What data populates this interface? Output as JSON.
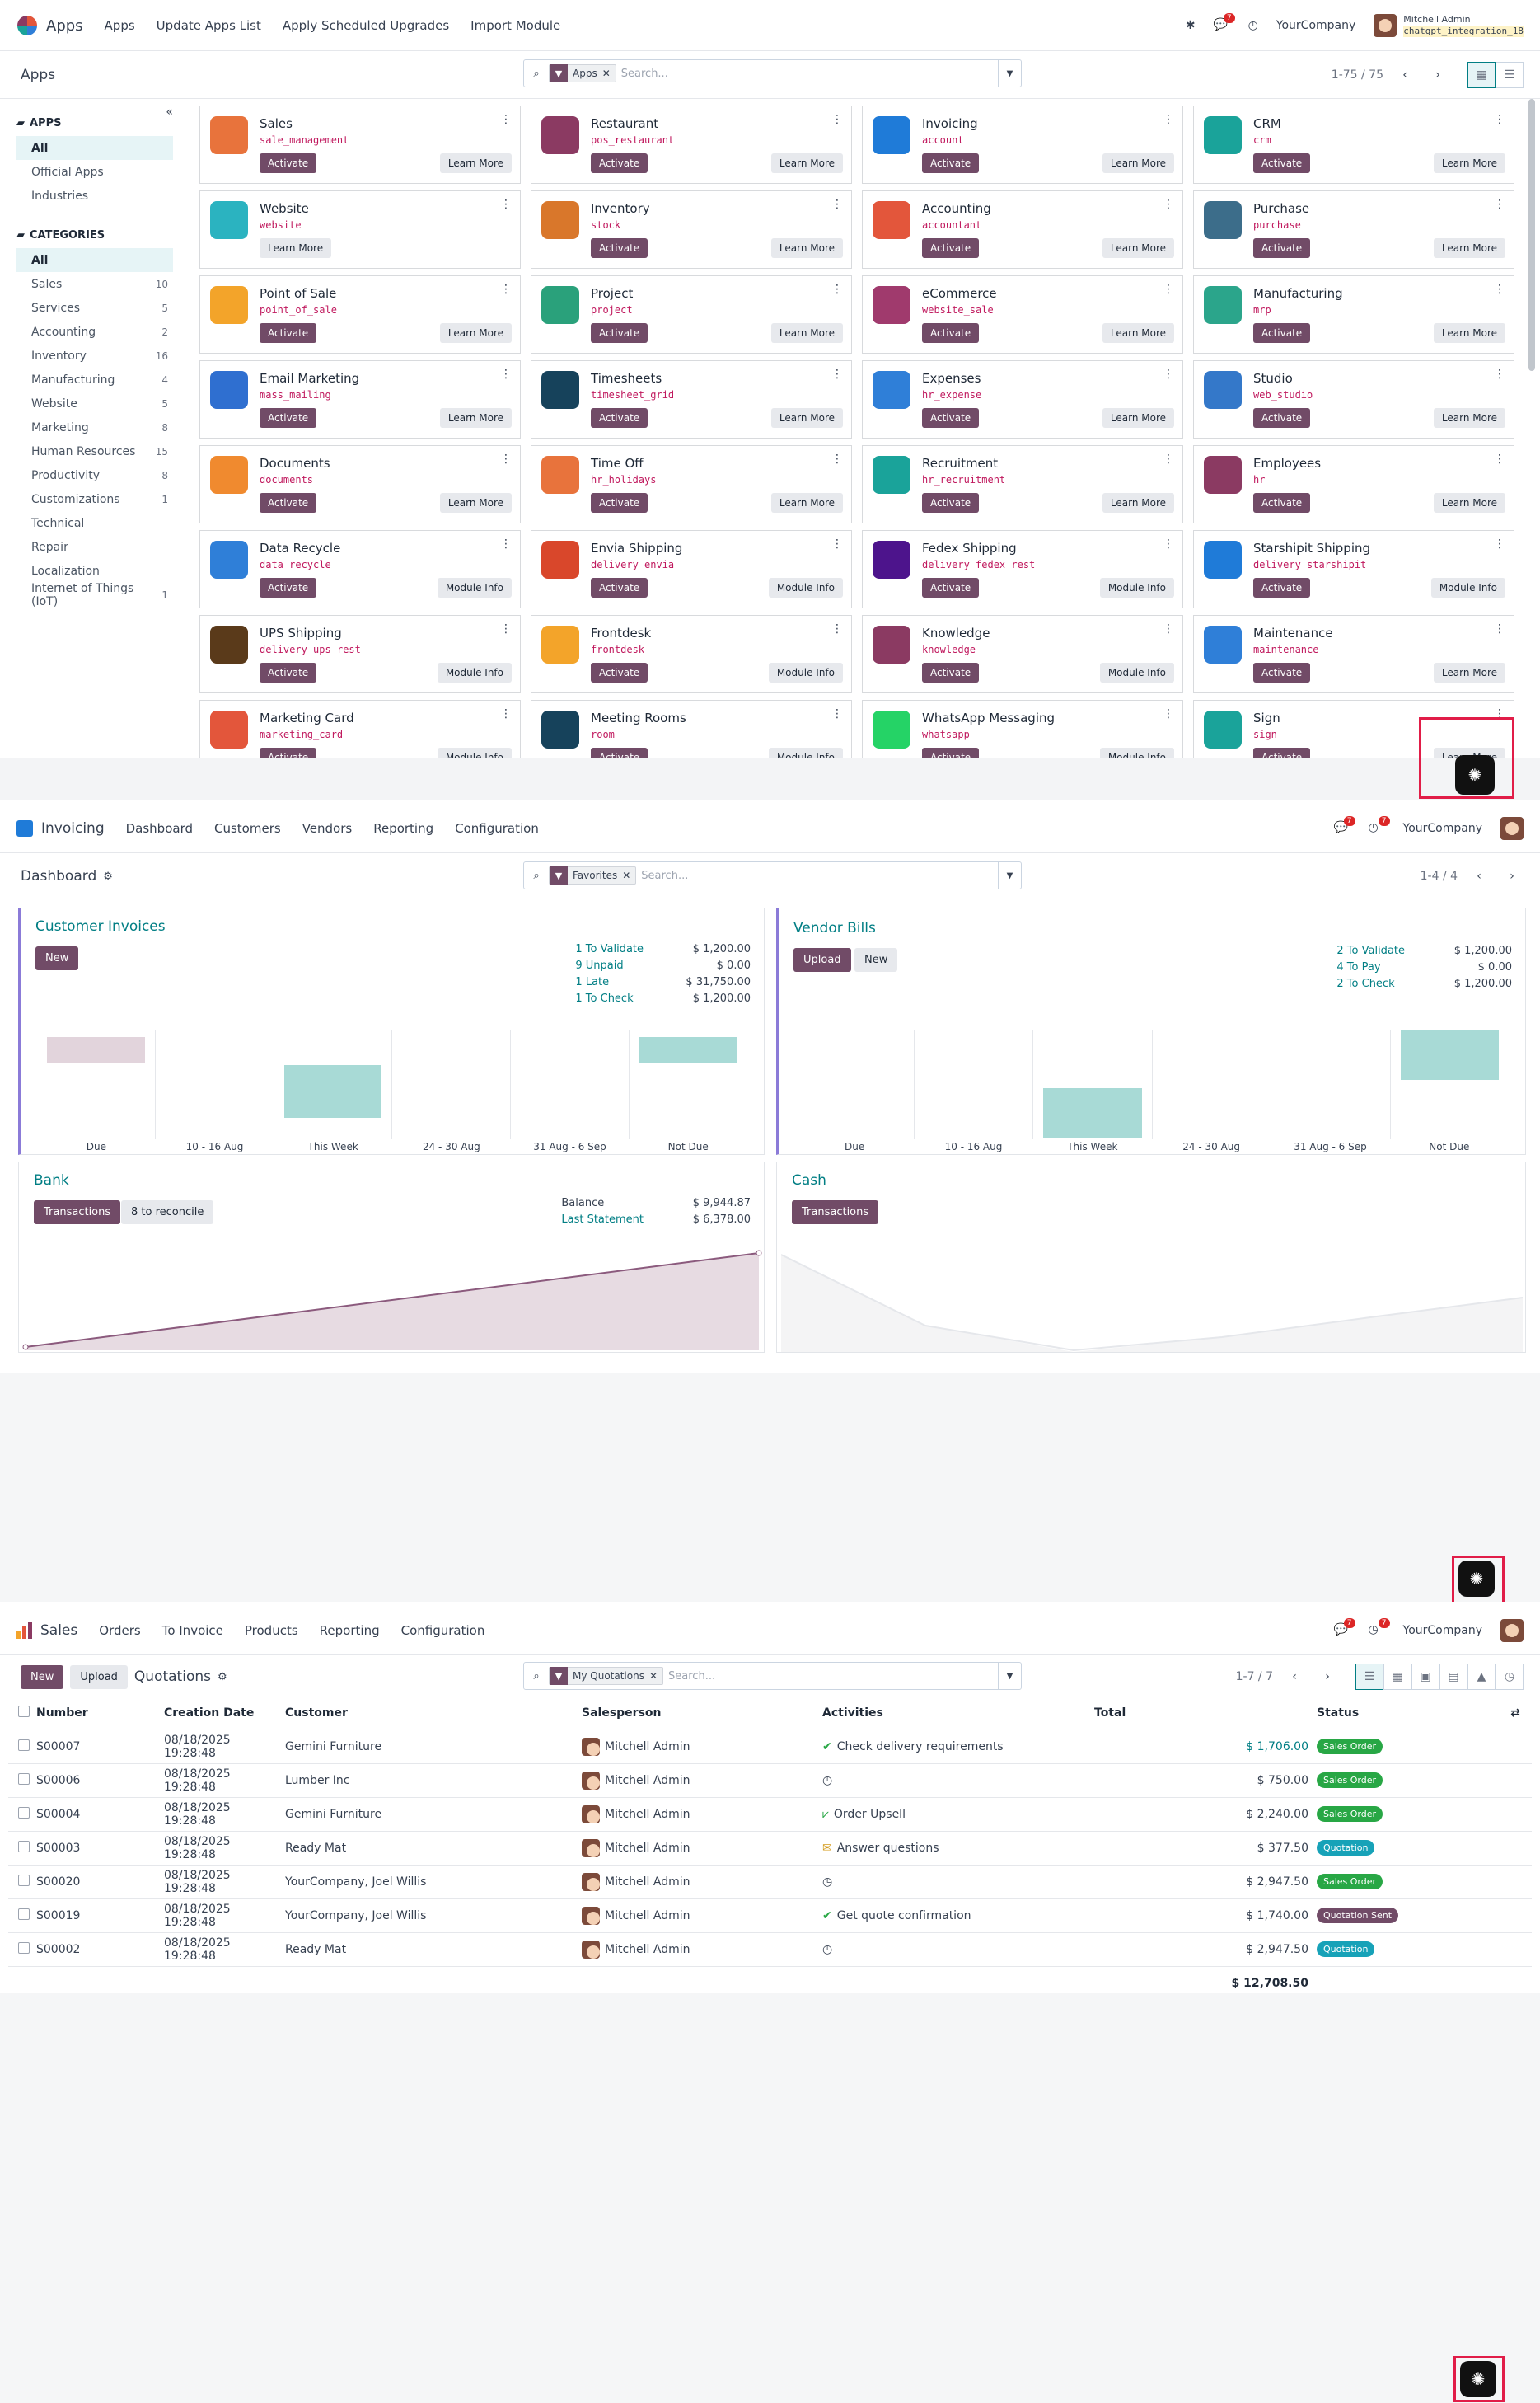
{
  "panel1": {
    "nav": {
      "app": "Apps",
      "menu": [
        "Apps",
        "Update Apps List",
        "Apply Scheduled Upgrades",
        "Import Module"
      ]
    },
    "user": {
      "name": "Mitchell Admin",
      "db": "chatgpt_integration_18",
      "company": "YourCompany",
      "msg_count": "7"
    },
    "breadcrumb": "Apps",
    "search": {
      "facet": "Apps",
      "placeholder": "Search..."
    },
    "pager": "1-75 / 75",
    "sidebar": {
      "apps_title": "APPS",
      "apps": [
        "All",
        "Official Apps",
        "Industries"
      ],
      "cat_title": "CATEGORIES",
      "categories": [
        {
          "label": "All",
          "count": ""
        },
        {
          "label": "Sales",
          "count": "10"
        },
        {
          "label": "Services",
          "count": "5"
        },
        {
          "label": "Accounting",
          "count": "2"
        },
        {
          "label": "Inventory",
          "count": "16"
        },
        {
          "label": "Manufacturing",
          "count": "4"
        },
        {
          "label": "Website",
          "count": "5"
        },
        {
          "label": "Marketing",
          "count": "8"
        },
        {
          "label": "Human Resources",
          "count": "15"
        },
        {
          "label": "Productivity",
          "count": "8"
        },
        {
          "label": "Customizations",
          "count": "1"
        },
        {
          "label": "Technical",
          "count": ""
        },
        {
          "label": "Repair",
          "count": ""
        },
        {
          "label": "Localization",
          "count": ""
        },
        {
          "label": "Internet of Things (IoT)",
          "count": "1"
        }
      ]
    },
    "apps": [
      {
        "name": "Sales",
        "tech": "sale_management",
        "act": "Activate",
        "more": "Learn More",
        "color": "#e8733c"
      },
      {
        "name": "Restaurant",
        "tech": "pos_restaurant",
        "act": "Activate",
        "more": "Learn More",
        "color": "#8b3a62"
      },
      {
        "name": "Invoicing",
        "tech": "account",
        "act": "Activate",
        "more": "Learn More",
        "color": "#1f7bd8"
      },
      {
        "name": "CRM",
        "tech": "crm",
        "act": "Activate",
        "more": "Learn More",
        "color": "#1aa39a"
      },
      {
        "name": "Website",
        "tech": "website",
        "act": "",
        "more": "Learn More",
        "color": "#2bb3c0"
      },
      {
        "name": "Inventory",
        "tech": "stock",
        "act": "Activate",
        "more": "Learn More",
        "color": "#d9772b"
      },
      {
        "name": "Accounting",
        "tech": "accountant",
        "act": "Activate",
        "more": "Learn More",
        "color": "#e3563b"
      },
      {
        "name": "Purchase",
        "tech": "purchase",
        "act": "Activate",
        "more": "Learn More",
        "color": "#3c6d8a"
      },
      {
        "name": "Point of Sale",
        "tech": "point_of_sale",
        "act": "Activate",
        "more": "Learn More",
        "color": "#f3a42a"
      },
      {
        "name": "Project",
        "tech": "project",
        "act": "Activate",
        "more": "Learn More",
        "color": "#2aa17b"
      },
      {
        "name": "eCommerce",
        "tech": "website_sale",
        "act": "Activate",
        "more": "Learn More",
        "color": "#a03a6d"
      },
      {
        "name": "Manufacturing",
        "tech": "mrp",
        "act": "Activate",
        "more": "Learn More",
        "color": "#2ba58b"
      },
      {
        "name": "Email Marketing",
        "tech": "mass_mailing",
        "act": "Activate",
        "more": "Learn More",
        "color": "#2f6fd0"
      },
      {
        "name": "Timesheets",
        "tech": "timesheet_grid",
        "act": "Activate",
        "more": "Learn More",
        "color": "#16425b"
      },
      {
        "name": "Expenses",
        "tech": "hr_expense",
        "act": "Activate",
        "more": "Learn More",
        "color": "#2f7fd8"
      },
      {
        "name": "Studio",
        "tech": "web_studio",
        "act": "Activate",
        "more": "Learn More",
        "color": "#3478c9"
      },
      {
        "name": "Documents",
        "tech": "documents",
        "act": "Activate",
        "more": "Learn More",
        "color": "#f08a2f"
      },
      {
        "name": "Time Off",
        "tech": "hr_holidays",
        "act": "Activate",
        "more": "Learn More",
        "color": "#e8733c"
      },
      {
        "name": "Recruitment",
        "tech": "hr_recruitment",
        "act": "Activate",
        "more": "Learn More",
        "color": "#1aa39a"
      },
      {
        "name": "Employees",
        "tech": "hr",
        "act": "Activate",
        "more": "Learn More",
        "color": "#8b3a62"
      },
      {
        "name": "Data Recycle",
        "tech": "data_recycle",
        "act": "Activate",
        "more": "Module Info",
        "color": "#2f7fd8"
      },
      {
        "name": "Envia Shipping",
        "tech": "delivery_envia",
        "act": "Activate",
        "more": "Module Info",
        "color": "#d9472b"
      },
      {
        "name": "Fedex Shipping",
        "tech": "delivery_fedex_rest",
        "act": "Activate",
        "more": "Module Info",
        "color": "#4d148c"
      },
      {
        "name": "Starshipit Shipping",
        "tech": "delivery_starshipit",
        "act": "Activate",
        "more": "Module Info",
        "color": "#1f7bd8"
      },
      {
        "name": "UPS Shipping",
        "tech": "delivery_ups_rest",
        "act": "Activate",
        "more": "Module Info",
        "color": "#5a3a1a"
      },
      {
        "name": "Frontdesk",
        "tech": "frontdesk",
        "act": "Activate",
        "more": "Module Info",
        "color": "#f3a42a"
      },
      {
        "name": "Knowledge",
        "tech": "knowledge",
        "act": "Activate",
        "more": "Module Info",
        "color": "#8b3a62"
      },
      {
        "name": "Maintenance",
        "tech": "maintenance",
        "act": "Activate",
        "more": "Learn More",
        "color": "#2f7fd8"
      },
      {
        "name": "Marketing Card",
        "tech": "marketing_card",
        "act": "Activate",
        "more": "Module Info",
        "color": "#e3563b"
      },
      {
        "name": "Meeting Rooms",
        "tech": "room",
        "act": "Activate",
        "more": "Module Info",
        "color": "#16425b"
      },
      {
        "name": "WhatsApp Messaging",
        "tech": "whatsapp",
        "act": "Activate",
        "more": "Module Info",
        "color": "#25d366"
      },
      {
        "name": "Sign",
        "tech": "sign",
        "act": "Activate",
        "more": "Learn More",
        "color": "#1aa39a"
      }
    ]
  },
  "panel2": {
    "nav": {
      "app": "Invoicing",
      "menu": [
        "Dashboard",
        "Customers",
        "Vendors",
        "Reporting",
        "Configuration"
      ]
    },
    "company": "YourCompany",
    "breadcrumb": "Dashboard",
    "search": {
      "facet": "Favorites",
      "placeholder": "Search..."
    },
    "pager": "1-4 / 4",
    "customer_invoices": {
      "title": "Customer Invoices",
      "button": "New",
      "stats": [
        {
          "label": "1 To Validate",
          "value": "$ 1,200.00"
        },
        {
          "label": "9 Unpaid",
          "value": "$ 0.00"
        },
        {
          "label": "1 Late",
          "value": "$ 31,750.00"
        },
        {
          "label": "1 To Check",
          "value": "$ 1,200.00"
        }
      ],
      "x": [
        "Due",
        "10 - 16 Aug",
        "This Week",
        "24 - 30 Aug",
        "31 Aug - 6 Sep",
        "Not Due"
      ]
    },
    "vendor_bills": {
      "title": "Vendor Bills",
      "button": "Upload",
      "button2": "New",
      "stats": [
        {
          "label": "2 To Validate",
          "value": "$ 1,200.00"
        },
        {
          "label": "4 To Pay",
          "value": "$ 0.00"
        },
        {
          "label": "2 To Check",
          "value": "$ 1,200.00"
        }
      ],
      "x": [
        "Due",
        "10 - 16 Aug",
        "This Week",
        "24 - 30 Aug",
        "31 Aug - 6 Sep",
        "Not Due"
      ]
    },
    "bank": {
      "title": "Bank",
      "button": "Transactions",
      "button2": "8 to reconcile",
      "stats": [
        {
          "label": "Balance",
          "value": "$ 9,944.87"
        },
        {
          "label": "Last Statement",
          "value": "$ 6,378.00"
        }
      ]
    },
    "cash": {
      "title": "Cash",
      "button": "Transactions"
    }
  },
  "panel3": {
    "nav": {
      "app": "Sales",
      "menu": [
        "Orders",
        "To Invoice",
        "Products",
        "Reporting",
        "Configuration"
      ]
    },
    "company": "YourCompany",
    "buttons": {
      "new": "New",
      "upload": "Upload"
    },
    "breadcrumb": "Quotations",
    "search": {
      "facet": "My Quotations",
      "placeholder": "Search..."
    },
    "pager": "1-7 / 7",
    "columns": [
      "Number",
      "Creation Date",
      "Customer",
      "Salesperson",
      "Activities",
      "Total",
      "Status"
    ],
    "rows": [
      {
        "number": "S00007",
        "date": "08/18/2025 19:28:48",
        "customer": "Gemini Furniture",
        "salesperson": "Mitchell Admin",
        "activity": "Check delivery requirements",
        "act_icon": "check",
        "total": "$ 1,706.00",
        "total_link": true,
        "status": "Sales Order",
        "status_color": "#28a745"
      },
      {
        "number": "S00006",
        "date": "08/18/2025 19:28:48",
        "customer": "Lumber Inc",
        "salesperson": "Mitchell Admin",
        "activity": "",
        "act_icon": "clock",
        "total": "$ 750.00",
        "total_link": false,
        "status": "Sales Order",
        "status_color": "#28a745"
      },
      {
        "number": "S00004",
        "date": "08/18/2025 19:28:48",
        "customer": "Gemini Furniture",
        "salesperson": "Mitchell Admin",
        "activity": "Order Upsell",
        "act_icon": "chart",
        "total": "$ 2,240.00",
        "total_link": false,
        "status": "Sales Order",
        "status_color": "#28a745"
      },
      {
        "number": "S00003",
        "date": "08/18/2025 19:28:48",
        "customer": "Ready Mat",
        "salesperson": "Mitchell Admin",
        "activity": "Answer questions",
        "act_icon": "mail",
        "total": "$ 377.50",
        "total_link": false,
        "status": "Quotation",
        "status_color": "#17a2b8"
      },
      {
        "number": "S00020",
        "date": "08/18/2025 19:28:48",
        "customer": "YourCompany, Joel Willis",
        "salesperson": "Mitchell Admin",
        "activity": "",
        "act_icon": "clock",
        "total": "$ 2,947.50",
        "total_link": false,
        "status": "Sales Order",
        "status_color": "#28a745"
      },
      {
        "number": "S00019",
        "date": "08/18/2025 19:28:48",
        "customer": "YourCompany, Joel Willis",
        "salesperson": "Mitchell Admin",
        "activity": "Get quote confirmation",
        "act_icon": "check",
        "total": "$ 1,740.00",
        "total_link": false,
        "status": "Quotation Sent",
        "status_color": "#714b67"
      },
      {
        "number": "S00002",
        "date": "08/18/2025 19:28:48",
        "customer": "Ready Mat",
        "salesperson": "Mitchell Admin",
        "activity": "",
        "act_icon": "clock",
        "total": "$ 2,947.50",
        "total_link": false,
        "status": "Quotation",
        "status_color": "#17a2b8"
      }
    ],
    "grand_total": "$ 12,708.50"
  }
}
